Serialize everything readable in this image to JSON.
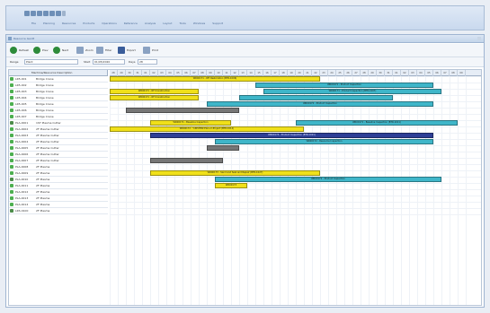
{
  "ribbon": {
    "tabs": [
      "File",
      "Planning",
      "Resources",
      "Products",
      "Operations",
      "Reference",
      "Analysis",
      "Layout",
      "Tools",
      "Windows",
      "Support"
    ]
  },
  "panel": {
    "title": "Resource Gantt"
  },
  "toolbar": {
    "buttons": [
      {
        "label": "Refresh",
        "icon": "refresh-icon",
        "color": "#2e8b3a"
      },
      {
        "label": "Prev",
        "icon": "back-icon",
        "color": "#2e8b3a"
      },
      {
        "label": "Next",
        "icon": "forward-icon",
        "color": "#2e8b3a"
      },
      {
        "label": "Zoom",
        "icon": "zoom-icon",
        "color": "#8aa2c2"
      },
      {
        "label": "Filter",
        "icon": "filter-icon",
        "color": "#8aa2c2"
      },
      {
        "label": "Export",
        "icon": "export-icon",
        "color": "#3a5d9a"
      },
      {
        "label": "Print",
        "icon": "print-icon",
        "color": "#8aa2c2"
      }
    ]
  },
  "filter": {
    "scope_label": "Range",
    "scope_value": "Plant",
    "from_label": "Start",
    "from_value": "01/05/2020",
    "to_label": "Days",
    "to_value": "28"
  },
  "grid": {
    "left_header": "Machine/Resource Description",
    "days": [
      "28",
      "29",
      "30",
      "31",
      "01",
      "02",
      "03",
      "04",
      "05",
      "06",
      "07",
      "08",
      "09",
      "10",
      "11",
      "12",
      "13",
      "14",
      "15",
      "16",
      "17",
      "18",
      "19",
      "20",
      "21",
      "22",
      "23",
      "24",
      "25",
      "26",
      "27",
      "28",
      "29",
      "30",
      "31",
      "01",
      "02",
      "03",
      "04",
      "05",
      "06",
      "07",
      "08",
      "09"
    ],
    "rows": [
      {
        "id": "LR5-001",
        "name": "Bridge Crane",
        "group": false
      },
      {
        "id": "LR5-002",
        "name": "Bridge Crane",
        "group": false
      },
      {
        "id": "LR5-003",
        "name": "Bridge Crane",
        "group": false
      },
      {
        "id": "LR5-004",
        "name": "Bridge Crane",
        "group": false
      },
      {
        "id": "LR5-005",
        "name": "Bridge Crane",
        "group": false
      },
      {
        "id": "LR5-006",
        "name": "Bridge Crane",
        "group": false
      },
      {
        "id": "LR5-007",
        "name": "Bridge Crane",
        "group": false
      },
      {
        "id": "PLA-0001",
        "name": "1ST Plasma Cutter",
        "group": true
      },
      {
        "id": "PLA-0002",
        "name": "2F Plasma Cutter",
        "group": false
      },
      {
        "id": "PLA-0003",
        "name": "2F Plasma Cutter",
        "group": false
      },
      {
        "id": "PLA-0004",
        "name": "2F Plasma Cutter",
        "group": false
      },
      {
        "id": "PLA-0005",
        "name": "2F Plasma Cutter",
        "group": false
      },
      {
        "id": "PLA-0006",
        "name": "2F Plasma Cutter",
        "group": false
      },
      {
        "id": "PLA-0007",
        "name": "2F Plasma Cutter",
        "group": false
      },
      {
        "id": "PLA-0008",
        "name": "2F Plasma",
        "group": false
      },
      {
        "id": "PLA-0009",
        "name": "2F Plasma",
        "group": false
      },
      {
        "id": "PLA-0010",
        "name": "2F Plasma",
        "group": true
      },
      {
        "id": "PLA-0011",
        "name": "2F Plasma",
        "group": false
      },
      {
        "id": "PLA-0012",
        "name": "2F Plasma",
        "group": false
      },
      {
        "id": "PLA-0013",
        "name": "2F Plasma",
        "group": false
      },
      {
        "id": "PLA-0014",
        "name": "2F Plasma",
        "group": false
      },
      {
        "id": "LRS-0100",
        "name": "2F Plasma",
        "group": true
      }
    ]
  },
  "bars": [
    {
      "row": 0,
      "start": 0,
      "end": 26,
      "color": "yellow",
      "label": "WR00171 - RFI Restoration (BTR-1006)"
    },
    {
      "row": 1,
      "start": 18,
      "end": 40,
      "color": "cyan",
      "label": "WR00171 - Product Inspection"
    },
    {
      "row": 2,
      "start": 0,
      "end": 11,
      "color": "yellow",
      "label": "WR00171 - RFI Construction"
    },
    {
      "row": 2,
      "start": 19,
      "end": 41,
      "color": "cyan",
      "label": "WR00171 - Product Inspection (BTR-1007)"
    },
    {
      "row": 3,
      "start": 0,
      "end": 11,
      "color": "yellow",
      "label": "WR00171 - RFI Construction"
    },
    {
      "row": 3,
      "start": 16,
      "end": 35,
      "color": "cyan",
      "label": ""
    },
    {
      "row": 4,
      "start": 12,
      "end": 40,
      "color": "cyan",
      "label": "WR00172 - Product Inspection"
    },
    {
      "row": 5,
      "start": 2,
      "end": 16,
      "color": "gray",
      "label": ""
    },
    {
      "row": 7,
      "start": 5,
      "end": 15,
      "color": "yellow",
      "label": "WR00171 - Baseline Inspection"
    },
    {
      "row": 7,
      "start": 23,
      "end": 43,
      "color": "cyan",
      "label": "WR00171 - Baseline Inspection (BTR-1011)"
    },
    {
      "row": 8,
      "start": 0,
      "end": 24,
      "color": "yellow",
      "label": "WR00172 - Y-REVIEW-Plan-or-Project (BTR-1014)"
    },
    {
      "row": 9,
      "start": 5,
      "end": 40,
      "color": "navy",
      "label": "WR00174 - Product Inspection (BTR-1021)"
    },
    {
      "row": 10,
      "start": 13,
      "end": 40,
      "color": "cyan",
      "label": "WR00172 - Resource Inspection"
    },
    {
      "row": 11,
      "start": 12,
      "end": 16,
      "color": "gray",
      "label": ""
    },
    {
      "row": 13,
      "start": 5,
      "end": 14,
      "color": "gray",
      "label": ""
    },
    {
      "row": 15,
      "start": 5,
      "end": 26,
      "color": "yellow",
      "label": "WR00173 - Sand and Seal and Repair (BTR-1027)"
    },
    {
      "row": 16,
      "start": 13,
      "end": 41,
      "color": "cyan",
      "label": "WR00172 - Product Inspection"
    },
    {
      "row": 17,
      "start": 13,
      "end": 17,
      "color": "yellow",
      "label": "WR00173"
    }
  ]
}
